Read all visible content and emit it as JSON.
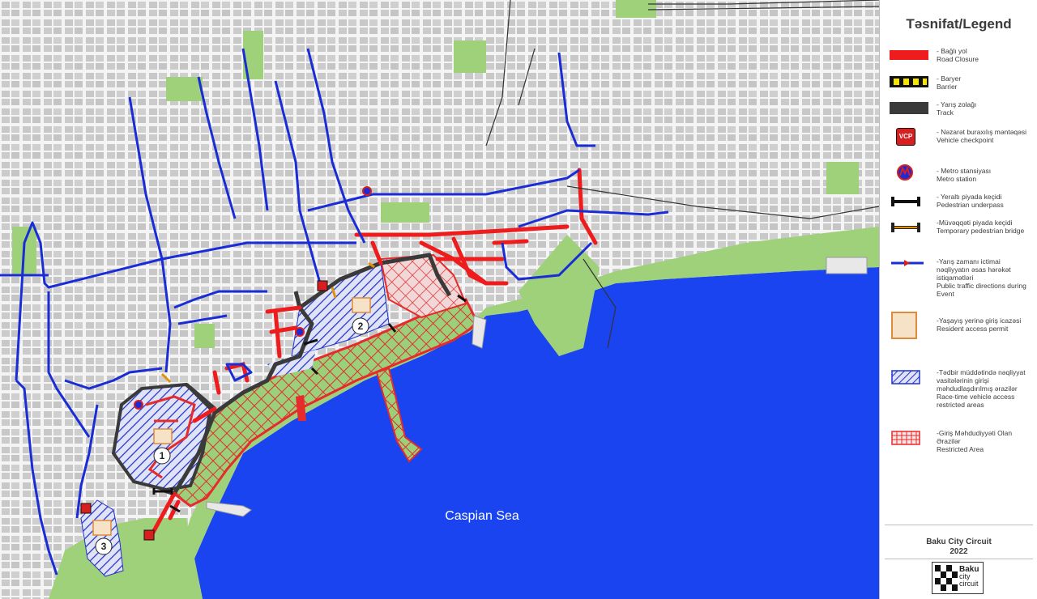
{
  "map": {
    "sea_label": "Caspian Sea",
    "zone_numbers": [
      "1",
      "2",
      "3"
    ],
    "colors": {
      "land": "#dcdcdc",
      "road": "#f5f5f5",
      "park": "#9fd07a",
      "sea": "#1a44f0",
      "closure": "#ee1c1c",
      "track": "#3a3a3a",
      "public_route": "#1a2cd6",
      "restricted_hatch": "#e52b2b",
      "vehicle_hatch": "#2233cc"
    }
  },
  "legend": {
    "title": "Təsnifat/Legend",
    "items": [
      {
        "icon": "road-closure-swatch",
        "az": "- Bağlı yol",
        "en": "Road Closure"
      },
      {
        "icon": "barrier-swatch",
        "az": "- Baryer",
        "en": "Barrier"
      },
      {
        "icon": "track-swatch",
        "az": "- Yarış zolağı",
        "en": "Track"
      },
      {
        "icon": "vcp-icon",
        "label": "VCP",
        "az": "- Nəzarət buraxılış məntəqəsi",
        "en": "Vehicle checkpoint"
      },
      {
        "icon": "metro-icon",
        "az": "- Metro stansiyası",
        "en": "Metro station"
      },
      {
        "icon": "pedestrian-underpass-icon",
        "az": "- Yeraltı piyada keçidi",
        "en": "Pedestrian underpass"
      },
      {
        "icon": "pedestrian-bridge-icon",
        "az": "-Müvəqqəti piyada keçidi",
        "en": "Temporary pedestrian bridge"
      },
      {
        "icon": "traffic-direction-arrow-icon",
        "az": "-Yarış zamanı ictimai nəqliyyatın əsas hərəkət istiqamətləri",
        "en": "Public traffic directions during Event"
      },
      {
        "icon": "resident-permit-icon",
        "az": "-Yaşayış yerinə giriş icazəsi",
        "en": "Resident access permit"
      },
      {
        "icon": "vehicle-restricted-area-swatch",
        "az": "-Tədbir müddətində nəqliyyat vasitələrinin girişi məhdudlaşdırılmış ərazilər",
        "en": "Race-time vehicle access restricted areas"
      },
      {
        "icon": "restricted-area-swatch",
        "az": "-Giriş Məhdudiyyəti Olan Ərazilər",
        "en": "Restricted Area"
      }
    ],
    "footer": {
      "line1": "Baku City Circuit",
      "line2": "2022"
    },
    "logo": {
      "word1": "Baku",
      "word2": "city",
      "word3": "circuit"
    }
  }
}
